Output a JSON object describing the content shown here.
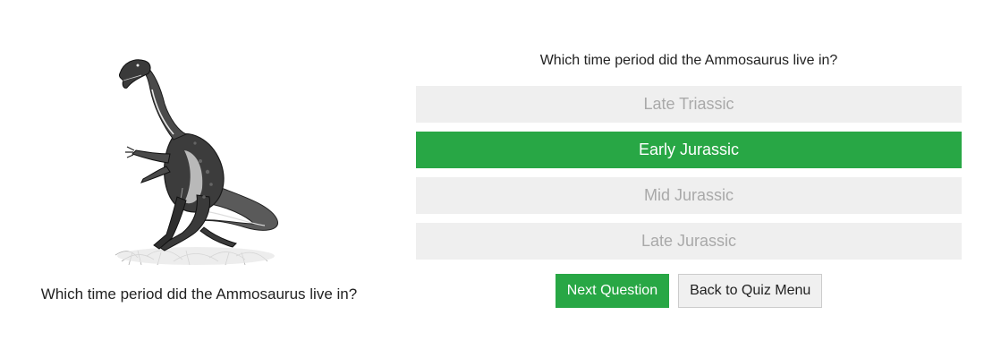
{
  "figure": {
    "icon": "ammosaurus-illustration"
  },
  "left_caption": "Which time period did the Ammosaurus live in?",
  "quiz": {
    "question": "Which time period did the Ammosaurus live in?",
    "answers": [
      {
        "label": "Late Triassic",
        "state": "disabled"
      },
      {
        "label": "Early Jurassic",
        "state": "correct"
      },
      {
        "label": "Mid Jurassic",
        "state": "disabled"
      },
      {
        "label": "Late Jurassic",
        "state": "disabled"
      }
    ]
  },
  "buttons": {
    "next_label": "Next Question",
    "back_label": "Back to Quiz Menu"
  },
  "colors": {
    "correct": "#28a745",
    "disabled_bg": "#efefef",
    "disabled_text": "#a9a9a9"
  }
}
